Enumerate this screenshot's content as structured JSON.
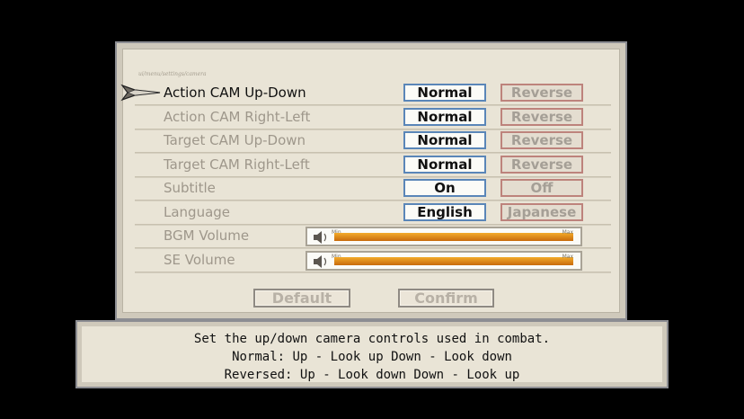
{
  "panel": {
    "header": "ui/menu/settings/camera"
  },
  "settings": [
    {
      "label": "Action CAM Up-Down",
      "active": true,
      "on": "Normal",
      "off": "Reverse"
    },
    {
      "label": "Action CAM Right-Left",
      "on": "Normal",
      "off": "Reverse"
    },
    {
      "label": "Target CAM Up-Down",
      "on": "Normal",
      "off": "Reverse"
    },
    {
      "label": "Target CAM Right-Left",
      "on": "Normal",
      "off": "Reverse"
    },
    {
      "label": "Subtitle",
      "on": "On",
      "off": "Off"
    },
    {
      "label": "Language",
      "on": "English",
      "off": "Japanese"
    }
  ],
  "volumes": [
    {
      "label": "BGM Volume",
      "min_label": "Min",
      "max_label": "Max",
      "level": 1.0
    },
    {
      "label": "SE Volume",
      "min_label": "Min",
      "max_label": "Max",
      "level": 1.0
    }
  ],
  "buttons": {
    "default": "Default",
    "confirm": "Confirm"
  },
  "help": {
    "line1": "Set the up/down camera controls used in combat.",
    "line2": "Normal:  Up - Look up      Down - Look down",
    "line3": "Reversed: Up - Look down   Down - Look up"
  },
  "colors": {
    "selected_border": "#5a86b8",
    "unselected_border": "#bd837c",
    "slider_fill": "#f3ab2a"
  }
}
